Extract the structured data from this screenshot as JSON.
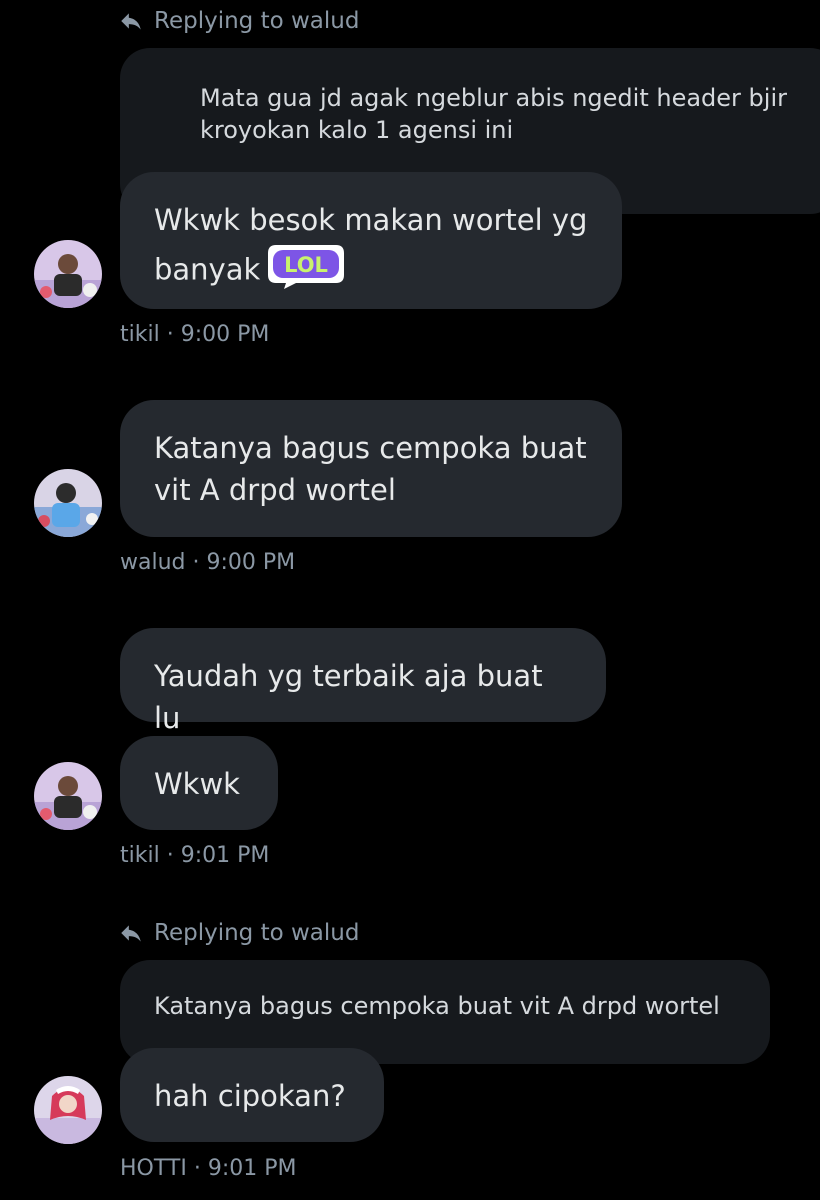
{
  "thread": {
    "reply1": {
      "label": "Replying to walud",
      "quote": [
        "Mata gua jd agak ngeblur abis ngedit header bjir",
        "kroyokan kalo 1 agensi ini"
      ]
    },
    "msg1": {
      "lines": [
        "Wkwk besok makan wortel yg",
        "banyak"
      ],
      "sticker": "LOL",
      "author": "tikil",
      "time": "9:00 PM"
    },
    "msg2": {
      "lines": [
        "Katanya bagus cempoka buat",
        "vit A drpd wortel"
      ],
      "author": "walud",
      "time": "9:00 PM"
    },
    "msg3": {
      "text": "Yaudah yg terbaik aja buat lu"
    },
    "msg4": {
      "text": "Wkwk",
      "author": "tikil",
      "time": "9:01 PM"
    },
    "reply2": {
      "label": "Replying to walud",
      "quote": "Katanya bagus cempoka buat vit A drpd wortel"
    },
    "msg5": {
      "text": "hah cipokan?",
      "author": "HOTTI",
      "time": "9:01 PM"
    }
  },
  "separator": "·",
  "icons": {
    "reply": "reply-arrow-icon",
    "sticker": "lol-sticker-icon"
  },
  "colors": {
    "background": "#000000",
    "bubble": "#25292f",
    "quote": "#16191d",
    "meta": "#8b98a5",
    "lol_purple": "#7d55e6",
    "lol_green": "#c8f26d"
  }
}
